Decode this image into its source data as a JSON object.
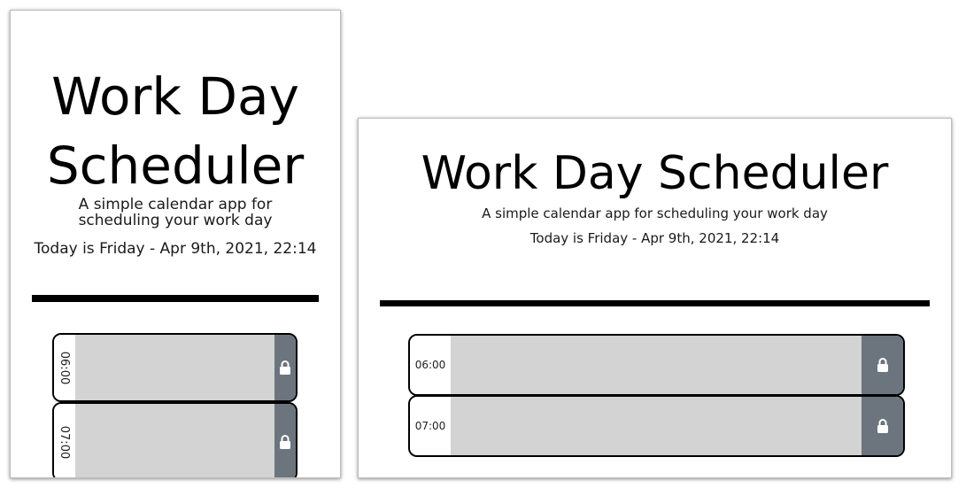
{
  "header": {
    "title": "Work Day Scheduler",
    "title_line1": "Work Day",
    "title_line2": "Scheduler",
    "subtitle": "A simple calendar app for scheduling your work day",
    "today": "Today is Friday - Apr 9th, 2021, 22:14"
  },
  "rows": [
    {
      "hour": "06:00",
      "text": "",
      "button_icon": "lock-icon"
    },
    {
      "hour": "07:00",
      "text": "",
      "button_icon": "lock-icon"
    }
  ],
  "colors": {
    "textarea_bg": "#d3d3d3",
    "button_bg": "#6c757d",
    "divider": "#000000"
  }
}
